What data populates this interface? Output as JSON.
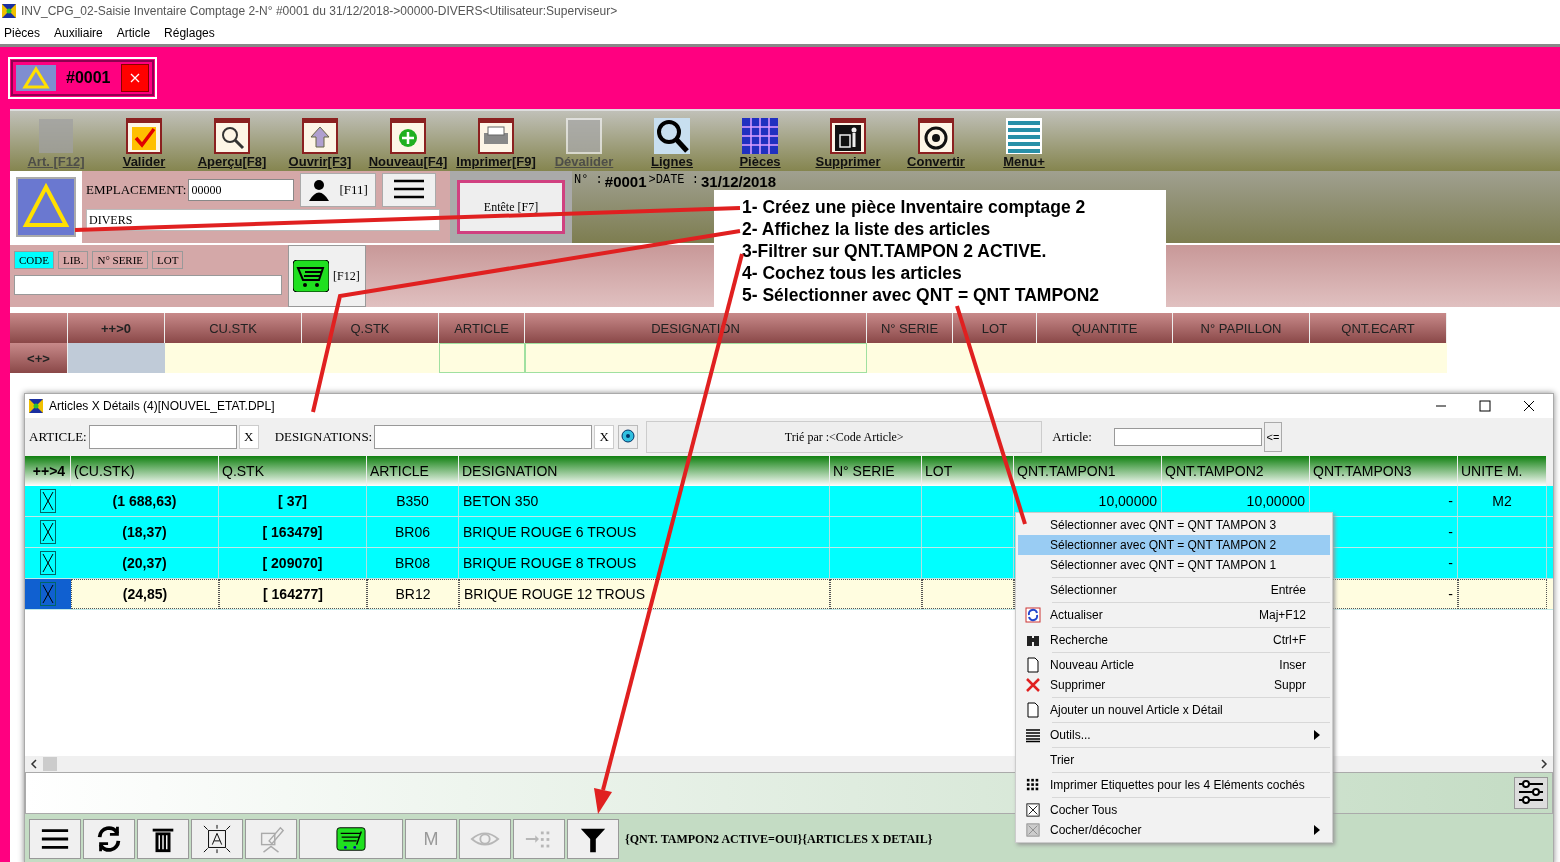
{
  "window": {
    "title": "INV_CPG_02-Saisie Inventaire Comptage 2-N° #0001 du 31/12/2018->00000-DIVERS<Utilisateur:Superviseur>"
  },
  "menu": [
    "Pièces",
    "Auxiliaire",
    "Article",
    "Réglages"
  ],
  "doc_tab": {
    "label": "#0001"
  },
  "toolbar": [
    {
      "label": "Art. [F12]",
      "disabled": true
    },
    {
      "label": "Valider",
      "disabled": false
    },
    {
      "label": "Aperçu[F8]",
      "disabled": false
    },
    {
      "label": "Ouvrir[F3]",
      "disabled": false
    },
    {
      "label": "Nouveau[F4]",
      "disabled": false
    },
    {
      "label": "Imprimer[F9]",
      "disabled": false
    },
    {
      "label": "Dévalider",
      "disabled": true
    },
    {
      "label": "Lignes",
      "disabled": false
    },
    {
      "label": "Pièces",
      "disabled": false
    },
    {
      "label": "Supprimer",
      "disabled": false
    },
    {
      "label": "Convertir",
      "disabled": false
    },
    {
      "label": "Menu+",
      "disabled": false
    }
  ],
  "header": {
    "location_label": "EMPLACEMENT:",
    "location_value": "00000",
    "contact_key": "[F11]",
    "name_value": "DIVERS",
    "header_button": "Entête [F7]",
    "number_label": "N° :",
    "number": "#0001",
    "date_label": ">DATE :",
    "date": "31/12/2018"
  },
  "search": {
    "tabs": [
      {
        "label": "CODE",
        "selected": true
      },
      {
        "label": "LIB.",
        "selected": false
      },
      {
        "label": "N° SERIE",
        "selected": false
      },
      {
        "label": "LOT",
        "selected": false
      }
    ],
    "cart_key": "[F12]"
  },
  "lines_grid": {
    "columns": [
      "",
      "++>0",
      "CU.STK",
      "Q.STK",
      "ARTICLE",
      "DESIGNATION",
      "N° SERIE",
      "LOT",
      "QUANTITE",
      "N° PAPILLON",
      "QNT.ECART"
    ],
    "new_row_label": "<+>"
  },
  "callout": [
    "1- Créez une pièce Inventaire comptage 2",
    "2- Affichez la liste des articles",
    "3-Filtrer sur QNT.TAMPON 2 ACTIVE.",
    "4- Cochez tous les articles",
    "5- Sélectionner avec QNT = QNT TAMPON2"
  ],
  "articles_window": {
    "title": "Articles X Détails (4)[NOUVEL_ETAT.DPL]",
    "article_label": "ARTICLE:",
    "designation_label": "DESIGNATIONS:",
    "article_clear_button": "X",
    "designation_clear_button": "X",
    "sort_label": "Trié par :<Code Article>",
    "article_search_label": "Article:",
    "go_button": "<=",
    "columns": [
      "++>4",
      "(CU.STK)",
      "Q.STK",
      "ARTICLE",
      "DESIGNATION",
      "N° SERIE",
      "LOT",
      "QNT.TAMPON1",
      "QNT.TAMPON2",
      "QNT.TAMPON3",
      "UNITE M."
    ],
    "rows": [
      {
        "checked": true,
        "selected": false,
        "cells": [
          "",
          "(1 688,63)",
          "[ 37]",
          "B350",
          "BETON 350",
          "",
          "",
          "10,00000",
          "10,00000",
          "-",
          "M2"
        ]
      },
      {
        "checked": true,
        "selected": false,
        "cells": [
          "",
          "(18,37)",
          "[ 163479]",
          "BR06",
          "BRIQUE ROUGE 6 TROUS",
          "",
          "",
          "",
          "",
          "-",
          ""
        ]
      },
      {
        "checked": true,
        "selected": false,
        "cells": [
          "",
          "(20,37)",
          "[ 209070]",
          "BR08",
          "BRIQUE ROUGE 8 TROUS",
          "",
          "",
          "",
          "",
          "-",
          ""
        ]
      },
      {
        "checked": true,
        "selected": true,
        "cells": [
          "",
          "(24,85)",
          "[ 164277]",
          "BR12",
          "BRIQUE ROUGE 12 TROUS",
          "",
          "",
          "",
          "",
          "-",
          ""
        ]
      }
    ],
    "bottom_buttons": [
      {
        "disabled": false
      },
      {
        "disabled": false
      },
      {
        "disabled": false
      },
      {
        "disabled": false
      },
      {
        "disabled": true
      },
      {
        "disabled": false
      },
      {
        "label": "M",
        "disabled": true
      },
      {
        "disabled": true
      },
      {
        "disabled": true
      },
      {
        "disabled": false
      }
    ],
    "filter_text": "{QNT. TAMPON2 ACTIVE=OUI}{ARTICLES X DETAIL}"
  },
  "context_menu": [
    [
      {
        "label": "Sélectionner avec QNT = QNT TAMPON 3",
        "submenu": false,
        "selected": false
      },
      {
        "label": "Sélectionner avec QNT = QNT TAMPON 2",
        "submenu": false,
        "selected": true
      },
      {
        "label": "Sélectionner avec QNT = QNT TAMPON 1",
        "submenu": false,
        "selected": false
      }
    ],
    [
      {
        "label": "Sélectionner",
        "shortcut": "Entrée",
        "submenu": false,
        "selected": false
      }
    ],
    [
      {
        "label": "Actualiser",
        "shortcut": "Maj+F12",
        "submenu": false,
        "selected": false
      }
    ],
    [
      {
        "label": "Recherche",
        "shortcut": "Ctrl+F",
        "submenu": false,
        "selected": false
      }
    ],
    [
      {
        "label": "Nouveau Article",
        "shortcut": "Inser",
        "submenu": false,
        "selected": false
      },
      {
        "label": "Supprimer",
        "shortcut": "Suppr",
        "submenu": false,
        "selected": false
      }
    ],
    [
      {
        "label": "Ajouter un nouvel Article x Détail",
        "submenu": false,
        "selected": false
      }
    ],
    [
      {
        "label": "Outils...",
        "submenu": true,
        "selected": false
      }
    ],
    [
      {
        "label": "Trier",
        "submenu": false,
        "selected": false
      }
    ],
    [
      {
        "label": "Imprimer Etiquettes pour les 4 Eléments cochés",
        "submenu": false,
        "selected": false
      }
    ],
    [
      {
        "label": "Cocher Tous",
        "submenu": false,
        "selected": false
      },
      {
        "label": "Cocher/décocher",
        "submenu": true,
        "selected": false
      }
    ]
  ]
}
